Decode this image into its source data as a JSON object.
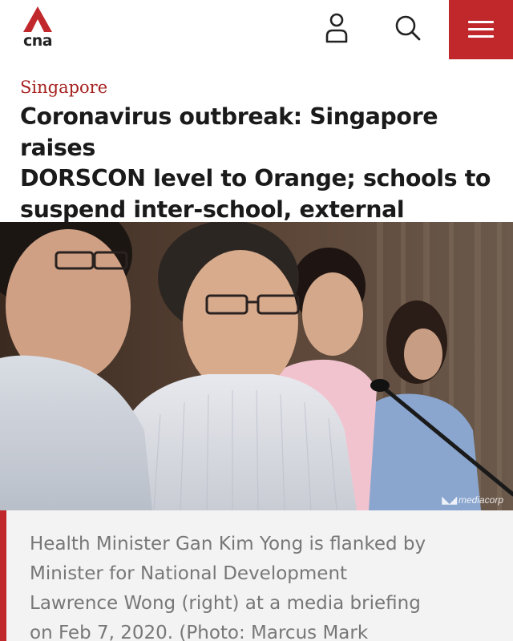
{
  "header": {
    "logo_text": "cna",
    "user_icon": "user-icon",
    "search_icon": "search-icon",
    "menu_icon": "hamburger-menu-icon",
    "brand_color": "#c0282c"
  },
  "article": {
    "category": "Singapore",
    "headline_line1": "Coronavirus outbreak: Singapore raises",
    "headline_line2": "DORSCON level to Orange; schools to",
    "headline_line3": "suspend inter-school, external activities",
    "photo_watermark": "mediacorp",
    "caption_line1": "Health Minister Gan Kim Yong is flanked by",
    "caption_line2": "Minister for National Development",
    "caption_line3": "Lawrence Wong (right) at a media briefing",
    "caption_line4": "on Feb 7, 2020. (Photo: Marcus Mark"
  }
}
